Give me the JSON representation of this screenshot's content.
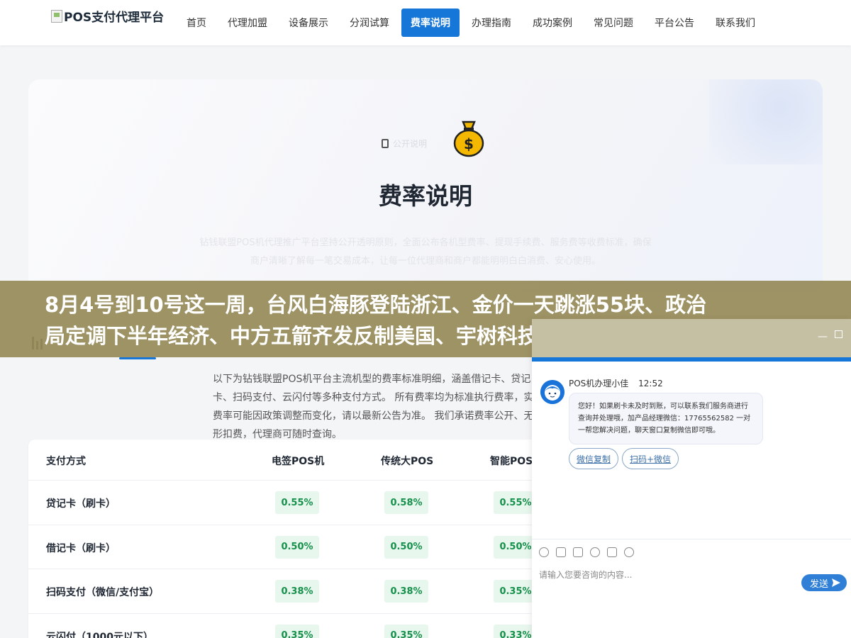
{
  "brand": {
    "logo_text": "POS支付代理平台"
  },
  "nav": {
    "items": [
      {
        "label": "首页"
      },
      {
        "label": "代理加盟"
      },
      {
        "label": "设备展示"
      },
      {
        "label": "分润试算"
      },
      {
        "label": "费率说明",
        "active": true
      },
      {
        "label": "办理指南"
      },
      {
        "label": "成功案例"
      },
      {
        "label": "常见问题"
      },
      {
        "label": "平台公告"
      },
      {
        "label": "联系我们"
      }
    ]
  },
  "hero": {
    "pill_label": "公开说明",
    "title": "费率说明",
    "desc": "钻钱联盟POS机代理推广平台坚持公开透明原则，全面公布各机型费率、提现手续费、服务费等收费标准，确保商户清晰了解每一笔交易成本，让每一位代理商和商户都能明明白白消费、安心使用。"
  },
  "headline": {
    "line1": "8月4号到10号这一周，台风白海豚登陆浙江、金价一天跳涨55块、政治",
    "line2": "局定调下半年经济、中方五箭齐发反制美国、宇树科技IPO开启申购、化"
  },
  "intro": "以下为钻钱联盟POS机平台主流机型的费率标准明细，涵盖借记卡、贷记卡、扫码支付、云闪付等多种支付方式。 所有费率均为标准执行费率，实际费率可能因政策调整而变化，请以最新公告为准。 我们承诺费率公开、无隐形扣费，代理商可随时查询。",
  "table": {
    "headers": [
      "支付方式",
      "电签POS机",
      "传统大POS",
      "智能POS"
    ],
    "rows": [
      {
        "name": "贷记卡（刷卡）",
        "rates": [
          "0.55%",
          "0.58%",
          "0.55%"
        ]
      },
      {
        "name": "借记卡（刷卡）",
        "rates": [
          "0.50%",
          "0.50%",
          "0.50%"
        ]
      },
      {
        "name": "扫码支付（微信/支付宝）",
        "rates": [
          "0.38%",
          "0.38%",
          "0.35%"
        ]
      },
      {
        "name": "云闪付（1000元以下）",
        "rates": [
          "0.35%",
          "0.35%",
          "0.33%"
        ]
      }
    ]
  },
  "chat": {
    "agent_name": "POS机办理小佳",
    "time": "12:52",
    "message": "您好！如果刷卡未及时到账，可以联系我们服务商进行查询并处理哦，加产品经理微信：17765562582 一对一帮您解决问题，聊天窗口复制微信即可哦。",
    "quick_buttons": [
      "微信复制",
      "扫码+微信"
    ],
    "input_placeholder": "请输入您要咨询的内容...",
    "send_label": "发送"
  }
}
